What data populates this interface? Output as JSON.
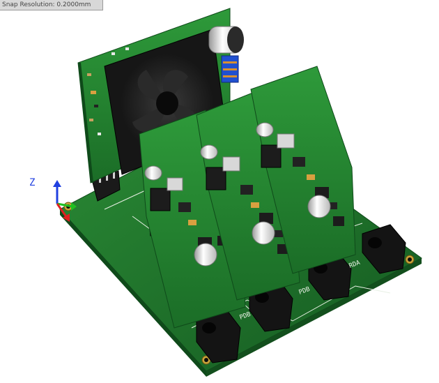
{
  "status": {
    "text": "Snap Resolution: 0.2000mm"
  },
  "axes": {
    "z_label": "Z"
  },
  "board": {
    "connector_labels": [
      "PDB",
      "PDB",
      "RDA"
    ]
  },
  "colors": {
    "pcb": "#1d6e2a",
    "pcb_dark": "#0f4a1a",
    "pcb_edge": "#2f8d3a",
    "silk": "#e8f0e4",
    "fan": "#1a1a1a",
    "jack": "#141414",
    "axis_x": "#e02020",
    "axis_y": "#20c020",
    "axis_z": "#2040e0"
  }
}
